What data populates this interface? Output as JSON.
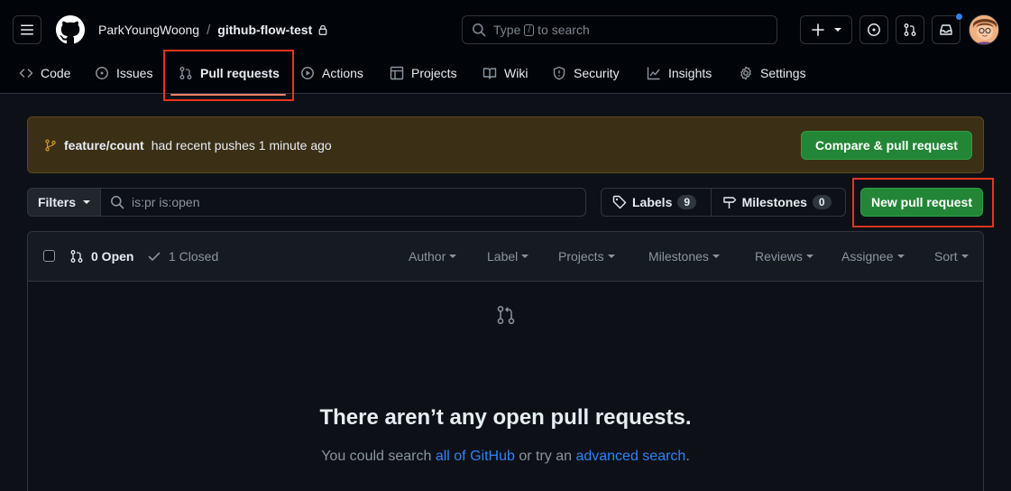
{
  "header": {
    "owner": "ParkYoungWoong",
    "separator": "/",
    "repo": "github-flow-test",
    "search_placeholder_prefix": "Type",
    "search_key": "/",
    "search_placeholder_suffix": "to search"
  },
  "tabs": [
    {
      "label": "Code",
      "icon": "code-icon"
    },
    {
      "label": "Issues",
      "icon": "issue-icon"
    },
    {
      "label": "Pull requests",
      "icon": "pull-request-icon",
      "active": true
    },
    {
      "label": "Actions",
      "icon": "play-icon"
    },
    {
      "label": "Projects",
      "icon": "table-icon"
    },
    {
      "label": "Wiki",
      "icon": "book-icon"
    },
    {
      "label": "Security",
      "icon": "shield-icon"
    },
    {
      "label": "Insights",
      "icon": "graph-icon"
    },
    {
      "label": "Settings",
      "icon": "gear-icon"
    }
  ],
  "banner": {
    "branch": "feature/count",
    "message": "had recent pushes 1 minute ago",
    "button": "Compare & pull request"
  },
  "filters": {
    "button": "Filters",
    "query": "is:pr is:open",
    "labels": "Labels",
    "labels_count": "9",
    "milestones": "Milestones",
    "milestones_count": "0",
    "new_pr": "New pull request"
  },
  "list": {
    "open": "0 Open",
    "closed": "1 Closed",
    "menus": [
      "Author",
      "Label",
      "Projects",
      "Milestones",
      "Reviews",
      "Assignee",
      "Sort"
    ]
  },
  "blankslate": {
    "title": "There aren’t any open pull requests.",
    "sub_before": "You could search ",
    "link1": "all of GitHub",
    "sub_middle": " or try an ",
    "link2": "advanced search",
    "sub_after": "."
  },
  "colors": {
    "accent_green": "#238636",
    "highlight_red": "#e5341f",
    "link_blue": "#2f81f7",
    "tab_underline": "#f78166"
  }
}
